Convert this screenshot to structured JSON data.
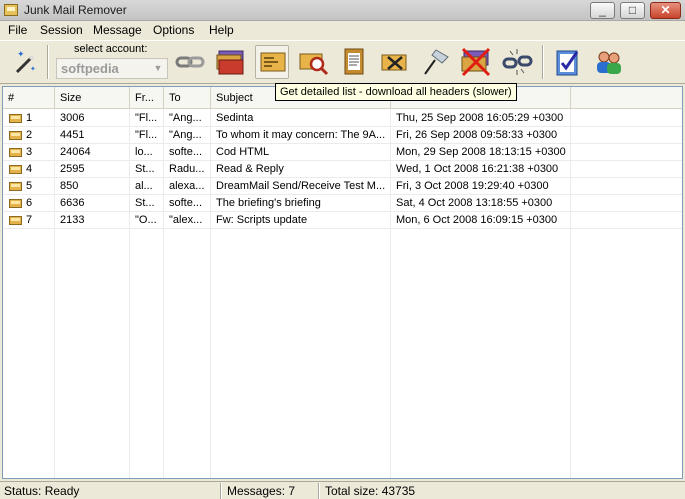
{
  "window": {
    "title": "Junk Mail Remover",
    "min": "_",
    "max": "□",
    "close": "✕"
  },
  "menu": [
    "File",
    "Session",
    "Message",
    "Options",
    "Help"
  ],
  "toolbar": {
    "account_label": "select account:",
    "account_value": "softpedia",
    "icons": [
      "wand-icon",
      "link-icon",
      "envelope-stack-icon",
      "detailed-list-icon",
      "search-message-icon",
      "document-icon",
      "delete-envelope-icon",
      "pin-icon",
      "mark-junk-icon",
      "disconnect-icon",
      "checklist-icon",
      "users-icon"
    ]
  },
  "tooltip": "Get detailed list - download all headers (slower)",
  "columns": [
    "#",
    "Size",
    "Fr...",
    "To",
    "Subject",
    ""
  ],
  "messages": [
    {
      "num": "1",
      "size": "3006",
      "from": "\"Fl...",
      "to": "\"Ang...",
      "subject": "Sedinta",
      "date": "Thu, 25 Sep 2008 16:05:29 +0300"
    },
    {
      "num": "2",
      "size": "4451",
      "from": "\"Fl...",
      "to": "\"Ang...",
      "subject": "To whom it may concern: The 9A...",
      "date": "Fri, 26 Sep 2008 09:58:33 +0300"
    },
    {
      "num": "3",
      "size": "24064",
      "from": "lo...",
      "to": "softe...",
      "subject": "Cod HTML",
      "date": "Mon, 29 Sep 2008 18:13:15 +0300"
    },
    {
      "num": "4",
      "size": "2595",
      "from": "St...",
      "to": "Radu...",
      "subject": "Read & Reply",
      "date": "Wed, 1 Oct 2008 16:21:38 +0300"
    },
    {
      "num": "5",
      "size": "850",
      "from": "al...",
      "to": "alexa...",
      "subject": "DreamMail Send/Receive Test M...",
      "date": "Fri, 3 Oct 2008 19:29:40 +0300"
    },
    {
      "num": "6",
      "size": "6636",
      "from": "St...",
      "to": "softe...",
      "subject": "The briefing's briefing",
      "date": "Sat, 4 Oct 2008 13:18:55 +0300"
    },
    {
      "num": "7",
      "size": "2133",
      "from": "\"O...",
      "to": "\"alex...",
      "subject": "Fw: Scripts update",
      "date": "Mon, 6 Oct 2008 16:09:15 +0300"
    }
  ],
  "status": {
    "state": "Status: Ready",
    "messages": "Messages: 7",
    "total": "Total size: 43735"
  },
  "colors": {
    "window_bg": "#ECE9D8",
    "tooltip_bg": "#FFFFE1",
    "list_border": "#7f9db9"
  }
}
